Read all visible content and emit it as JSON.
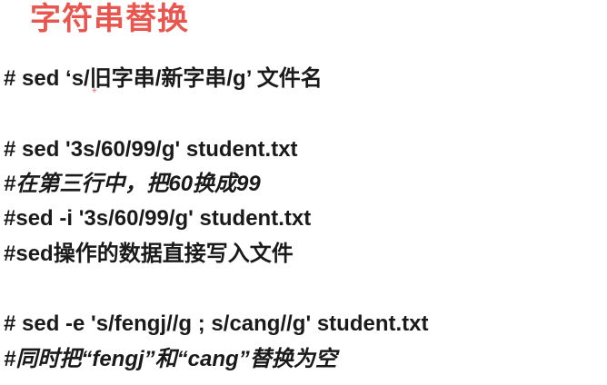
{
  "title": "字符串替换",
  "lines": [
    "# sed  ‘s/旧字串/新字串/g’  文件名",
    "# sed '3s/60/99/g' student.txt",
    "#在第三行中，把60换成99",
    "#sed -i '3s/60/99/g' student.txt",
    "#sed操作的数据直接写入文件",
    "# sed -e 's/fengj//g ; s/cang//g' student.txt",
    "#同时把“fengj”和“cang”替换为空"
  ],
  "colors": {
    "title": "#e8564f",
    "text": "#1a1a1a",
    "background": "#ffffff"
  }
}
